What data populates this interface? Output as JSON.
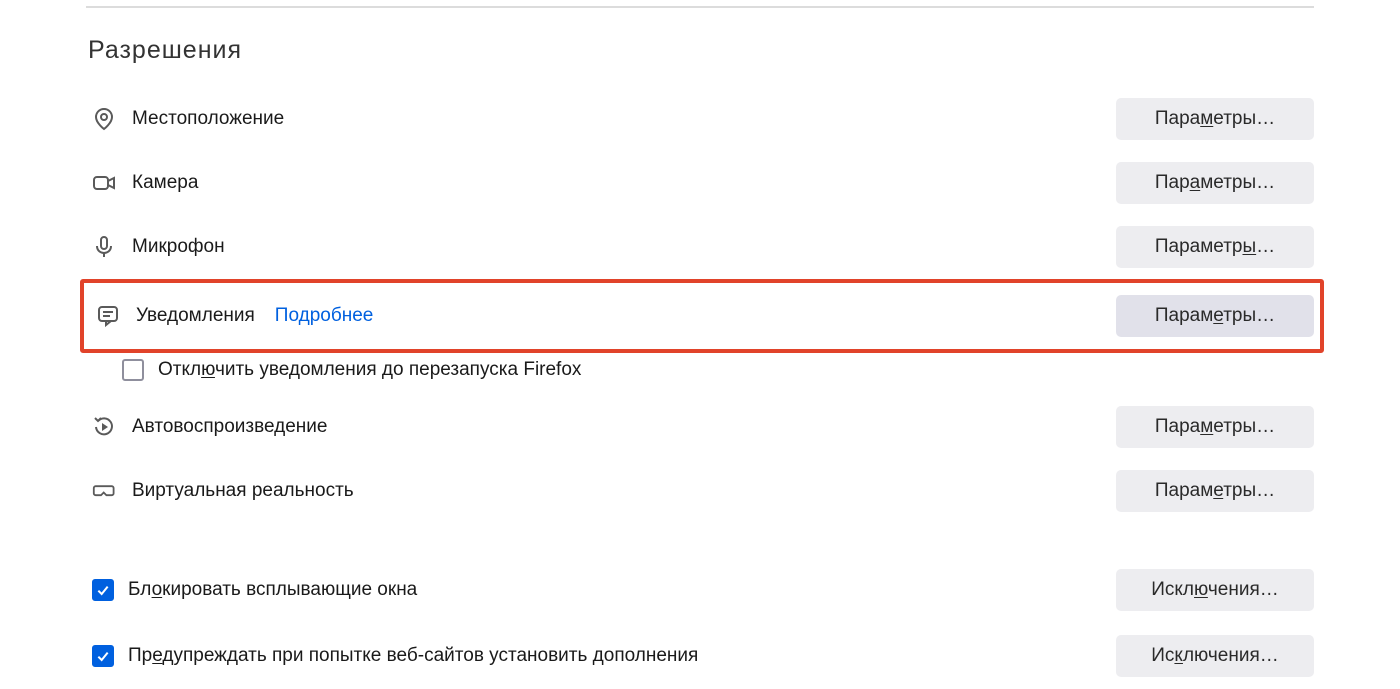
{
  "section": {
    "title": "Разрешения"
  },
  "perm": {
    "location": {
      "label": "Местоположение",
      "btn_pre": "Пара",
      "btn_u": "м",
      "btn_post": "етры…"
    },
    "camera": {
      "label": "Камера",
      "btn_pre": "Пар",
      "btn_u": "а",
      "btn_post": "метры…"
    },
    "microphone": {
      "label": "Микрофон",
      "btn_pre": "Параметр",
      "btn_u": "ы",
      "btn_post": "…"
    },
    "notifications": {
      "label": "Уведомления",
      "more": "Подробнее",
      "btn_pre": "Парам",
      "btn_u": "е",
      "btn_post": "тры…"
    },
    "pause_notif": {
      "label_pre": "Откл",
      "label_u": "ю",
      "label_post": "чить уведомления до перезапуска Firefox"
    },
    "autoplay": {
      "label": "Автовоспроизведение",
      "btn_pre": "Пара",
      "btn_u": "м",
      "btn_post": "етры…"
    },
    "vr": {
      "label": "Виртуальная реальность",
      "btn_pre": "Парам",
      "btn_u": "е",
      "btn_post": "тры…"
    }
  },
  "misc": {
    "popups": {
      "label_pre": "Бл",
      "label_u": "о",
      "label_post": "кировать всплывающие окна",
      "btn_pre": "Искл",
      "btn_u": "ю",
      "btn_post": "чения…"
    },
    "addons": {
      "label_pre": "Пр",
      "label_u": "е",
      "label_post": "дупреждать при попытке веб-сайтов установить дополнения",
      "btn_pre": "Ис",
      "btn_u": "к",
      "btn_post": "лючения…"
    }
  }
}
